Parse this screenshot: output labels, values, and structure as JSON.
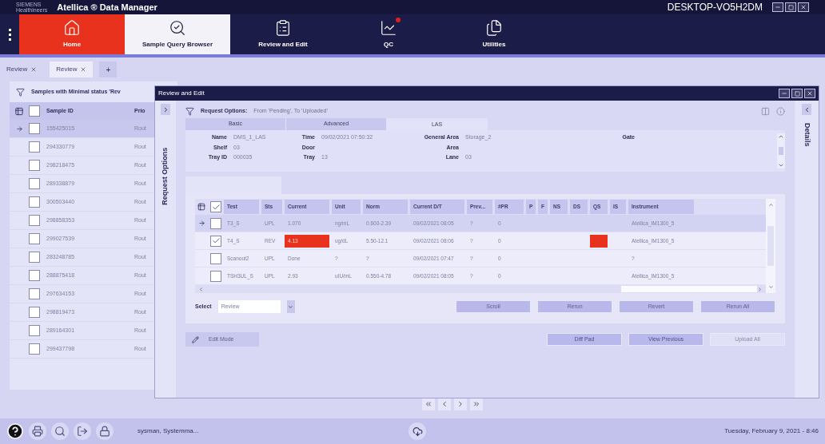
{
  "title_bar": {
    "brand_top": "SIEMENS",
    "brand_bottom": "Healthineers",
    "app_title": "Atellica ® Data Manager",
    "computer": "DESKTOP-VO5H2DM"
  },
  "nav": [
    {
      "kind": "home",
      "label": "Home",
      "selected": false,
      "alert": false
    },
    {
      "kind": "query",
      "label": "Sample Query Browser",
      "selected": true,
      "alert": false
    },
    {
      "kind": "review",
      "label": "Review and Edit",
      "selected": false,
      "alert": false
    },
    {
      "kind": "qc",
      "label": "QC",
      "selected": false,
      "alert": true
    },
    {
      "kind": "utilities",
      "label": "Utilities",
      "selected": false,
      "alert": false
    }
  ],
  "doc_tabs": [
    {
      "label": "Review",
      "selected": false
    },
    {
      "label": "Review",
      "selected": true
    }
  ],
  "add_tab": "+",
  "samples": {
    "header_checked": false,
    "filter": "Samples with Minimal status 'Rev",
    "columns": [
      "Sample ID",
      "Prio"
    ],
    "rows": [
      {
        "id": "155425015",
        "priority": "Rout",
        "selected": true
      },
      {
        "id": "294330779",
        "priority": "Rout",
        "selected": false
      },
      {
        "id": "298218475",
        "priority": "Rout",
        "selected": false
      },
      {
        "id": "289338879",
        "priority": "Rout",
        "selected": false
      },
      {
        "id": "300503440",
        "priority": "Rout",
        "selected": false
      },
      {
        "id": "298858353",
        "priority": "Rout",
        "selected": false
      },
      {
        "id": "299027539",
        "priority": "Rout",
        "selected": false
      },
      {
        "id": "283248785",
        "priority": "Rout",
        "selected": false
      },
      {
        "id": "288875418",
        "priority": "Rout",
        "selected": false
      },
      {
        "id": "297634153",
        "priority": "Rout",
        "selected": false
      },
      {
        "id": "298819473",
        "priority": "Rout",
        "selected": false
      },
      {
        "id": "289164301",
        "priority": "Rout",
        "selected": false
      },
      {
        "id": "299437798",
        "priority": "Rout",
        "selected": false
      }
    ]
  },
  "dialog": {
    "title": "Review and Edit",
    "side_left": "Request Options",
    "side_right": "Details",
    "request_label": "Request Options:",
    "request_value": "From 'Pending', To 'Uploaded'",
    "tabs": [
      {
        "label": "Basic",
        "selected": false
      },
      {
        "label": "Advanced",
        "selected": false
      },
      {
        "label": "LAS",
        "selected": true
      }
    ],
    "fields": [
      [
        {
          "label": "Name",
          "value": "DMS_1_LAS"
        },
        {
          "label": "Time",
          "value": "09/02/2021 07:50:32"
        },
        {
          "label": "General Area",
          "value": "Storage_2"
        },
        {
          "label": "Gate"
        }
      ],
      [
        {
          "label": "Shelf",
          "value": "03"
        },
        {
          "label": "Door"
        },
        {
          "label": "Area"
        }
      ],
      [
        {
          "label": "Tray ID",
          "value": "000035"
        },
        {
          "label": "Tray",
          "value": "13"
        },
        {
          "label": "Lane",
          "value": "03"
        }
      ]
    ],
    "columns": [
      "Test",
      "Sts",
      "Current",
      "Unit",
      "Norm",
      "Current D/T",
      "Prev...",
      "#PR",
      "P",
      "F",
      "NS",
      "DS",
      "QS",
      "IS",
      "Instrument"
    ],
    "header_checked": true,
    "tests": [
      {
        "current_row": true,
        "checked": false,
        "test": "T3_S",
        "sts": "UPL",
        "current": "1.070",
        "current_flag": false,
        "unit": "ng/mL",
        "norm": "0.600-2.39",
        "dt": "09/02/2021 08:05",
        "prev": "?",
        "pr": "0",
        "qs_flag": false,
        "instrument": "Atellica_IM1300_5"
      },
      {
        "current_row": false,
        "checked": true,
        "test": "T4_S",
        "sts": "REV",
        "current": "4.13",
        "current_flag": true,
        "unit": "ug/dL",
        "norm": "5.50-12.1",
        "dt": "09/02/2021 08:06",
        "prev": "?",
        "pr": "0",
        "qs_flag": true,
        "instrument": "Atellica_IM1300_5"
      },
      {
        "current_row": false,
        "checked": false,
        "test": "Scanout2",
        "sts": "UPL",
        "current": "Done",
        "current_flag": false,
        "unit": "?",
        "norm": "?",
        "dt": "09/02/2021 07:47",
        "prev": "?",
        "pr": "0",
        "qs_flag": false,
        "instrument": "?"
      },
      {
        "current_row": false,
        "checked": false,
        "test": "TSH3UL_S",
        "sts": "UPL",
        "current": "2.93",
        "current_flag": false,
        "unit": "uIU/mL",
        "norm": "0.550-4.78",
        "dt": "09/02/2021 08:05",
        "prev": "?",
        "pr": "0",
        "qs_flag": false,
        "instrument": "Atellica_IM1300_5"
      }
    ],
    "select_label": "Select",
    "select_value": "Review",
    "action_buttons": [
      {
        "label": "Scroll",
        "disabled": false
      },
      {
        "label": "Rerun",
        "disabled": false
      },
      {
        "label": "Revert",
        "disabled": false
      },
      {
        "label": "Rerun All",
        "disabled": false
      }
    ],
    "edit_mode": "Edit Mode",
    "bottom_buttons": [
      {
        "label": "Diff Pad",
        "disabled": false
      },
      {
        "label": "View Previous",
        "disabled": false
      },
      {
        "label": "Upload All",
        "disabled": true
      }
    ]
  },
  "status_bar": {
    "user": "sysman, Systemma...",
    "datetime": "Tuesday, February 9, 2021 - 8:46"
  }
}
